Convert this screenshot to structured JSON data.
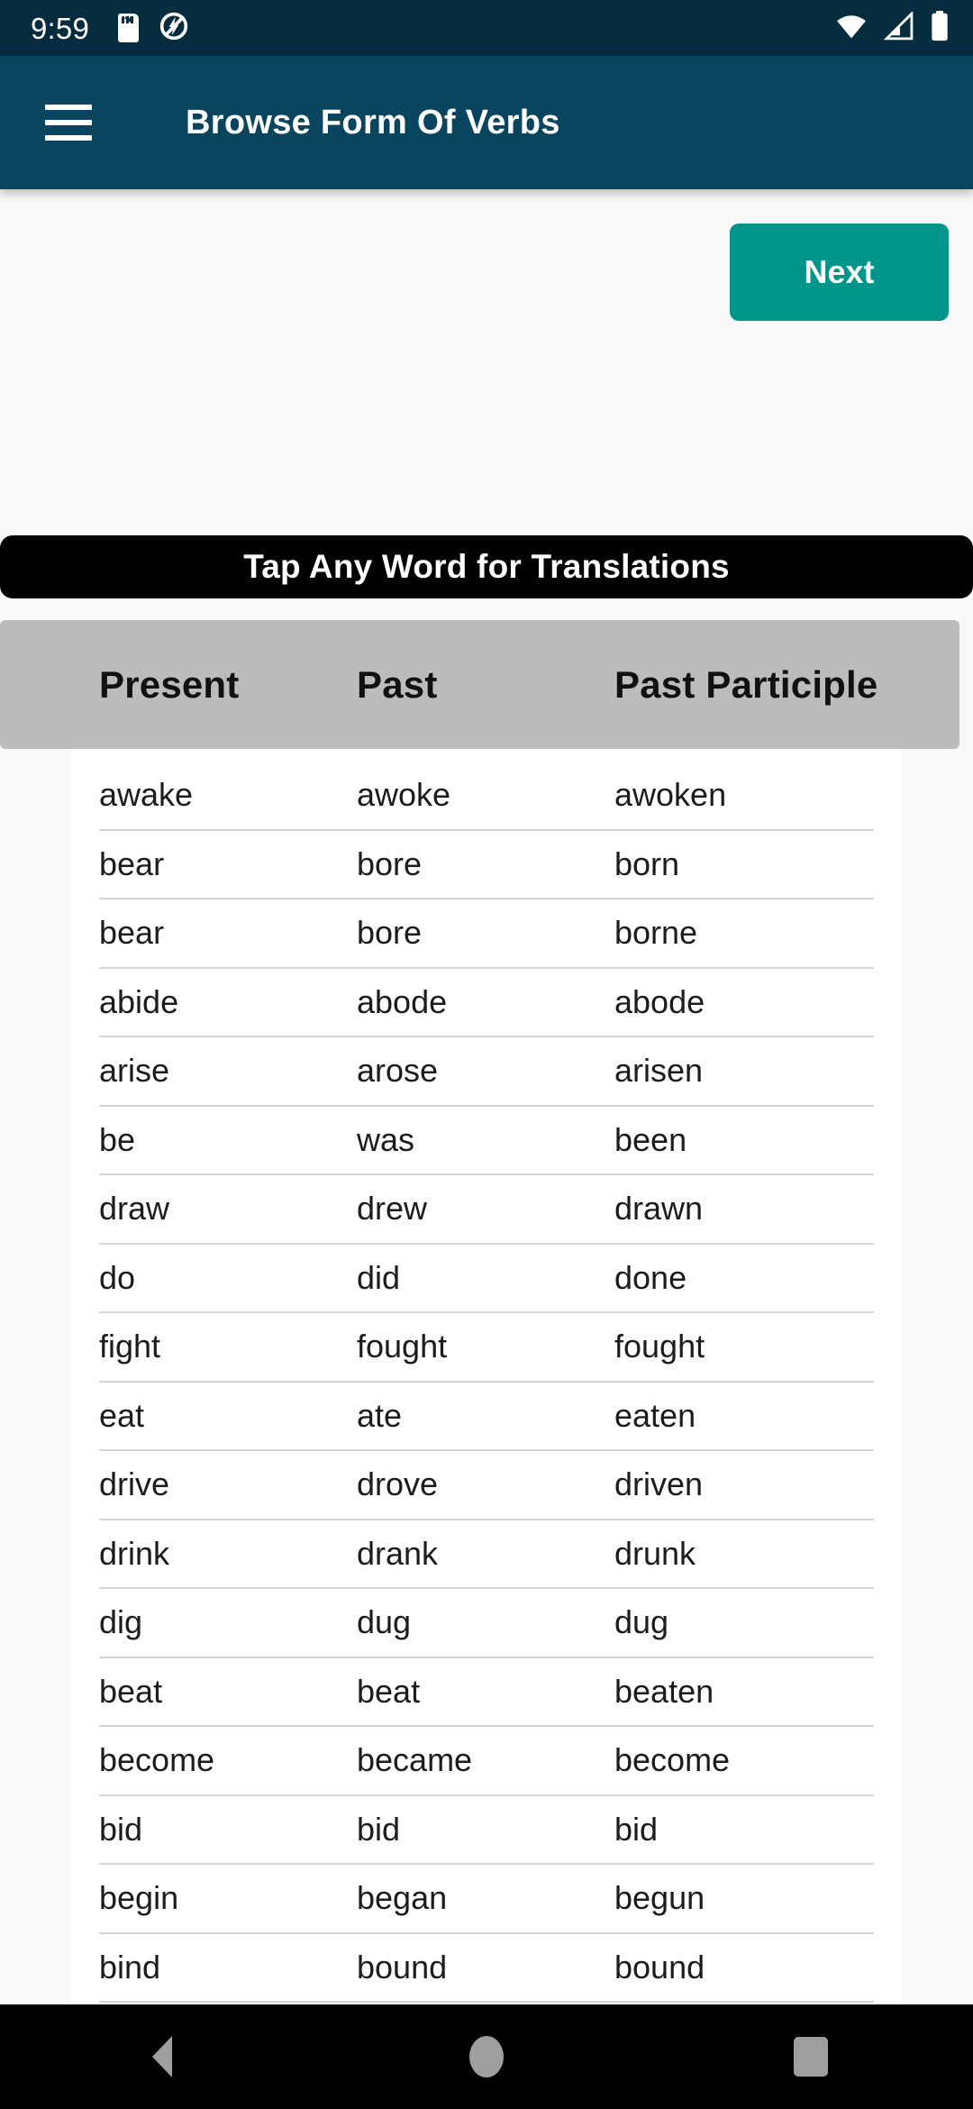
{
  "status_bar": {
    "time": "9:59",
    "icons_left": [
      "sdcard-icon",
      "no-flash-icon"
    ],
    "icons_right": [
      "wifi-icon",
      "cellular-signal-icon",
      "battery-icon"
    ]
  },
  "app_bar": {
    "menu_icon": "hamburger-menu-icon",
    "title": "Browse Form Of Verbs"
  },
  "toolbar": {
    "next_label": "Next"
  },
  "banner": {
    "text": "Tap Any Word for Translations"
  },
  "table": {
    "headers": [
      "Present",
      "Past",
      "Past Participle"
    ],
    "rows": [
      [
        "awake",
        "awoke",
        "awoken"
      ],
      [
        "bear",
        "bore",
        "born"
      ],
      [
        "bear",
        "bore",
        "borne"
      ],
      [
        "abide",
        "abode",
        "abode"
      ],
      [
        "arise",
        "arose",
        "arisen"
      ],
      [
        "be",
        "was",
        "been"
      ],
      [
        "draw",
        "drew",
        "drawn"
      ],
      [
        "do",
        "did",
        "done"
      ],
      [
        "fight",
        "fought",
        "fought"
      ],
      [
        "eat",
        "ate",
        "eaten"
      ],
      [
        "drive",
        "drove",
        "driven"
      ],
      [
        "drink",
        "drank",
        "drunk"
      ],
      [
        "dig",
        "dug",
        "dug"
      ],
      [
        "beat",
        "beat",
        "beaten"
      ],
      [
        "become",
        "became",
        "become"
      ],
      [
        "bid",
        "bid",
        "bid"
      ],
      [
        "begin",
        "began",
        "begun"
      ],
      [
        "bind",
        "bound",
        "bound"
      ]
    ]
  },
  "nav_bar": {
    "back": "back-triangle-icon",
    "home": "home-circle-icon",
    "recents": "recents-square-icon"
  },
  "colors": {
    "status_bar_bg": "#062c40",
    "app_bar_bg": "#0a4560",
    "accent_teal": "#00958a",
    "banner_bg": "#000000",
    "table_head_bg": "#bcbcbc",
    "page_bg": "#f8f8f8"
  }
}
